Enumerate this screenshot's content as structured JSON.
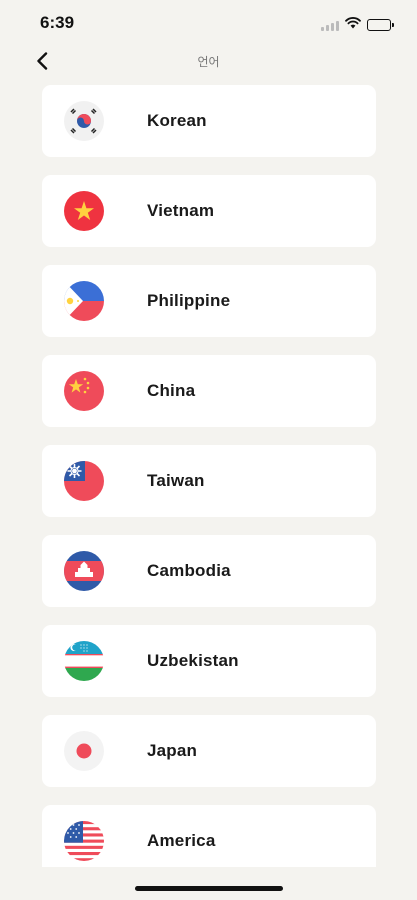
{
  "status_bar": {
    "time": "6:39"
  },
  "nav": {
    "title": "언어"
  },
  "languages": [
    {
      "label": "Korean",
      "icon": "korea-flag-icon"
    },
    {
      "label": "Vietnam",
      "icon": "vietnam-flag-icon"
    },
    {
      "label": "Philippine",
      "icon": "philippines-flag-icon"
    },
    {
      "label": "China",
      "icon": "china-flag-icon"
    },
    {
      "label": "Taiwan",
      "icon": "taiwan-flag-icon"
    },
    {
      "label": "Cambodia",
      "icon": "cambodia-flag-icon"
    },
    {
      "label": "Uzbekistan",
      "icon": "uzbekistan-flag-icon"
    },
    {
      "label": "Japan",
      "icon": "japan-flag-icon"
    },
    {
      "label": "America",
      "icon": "usa-flag-icon"
    }
  ],
  "colors": {
    "background": "#f4f3ef",
    "card": "#ffffff",
    "flag_red": "#ef4b5a",
    "flag_blue": "#2f5aa8"
  }
}
